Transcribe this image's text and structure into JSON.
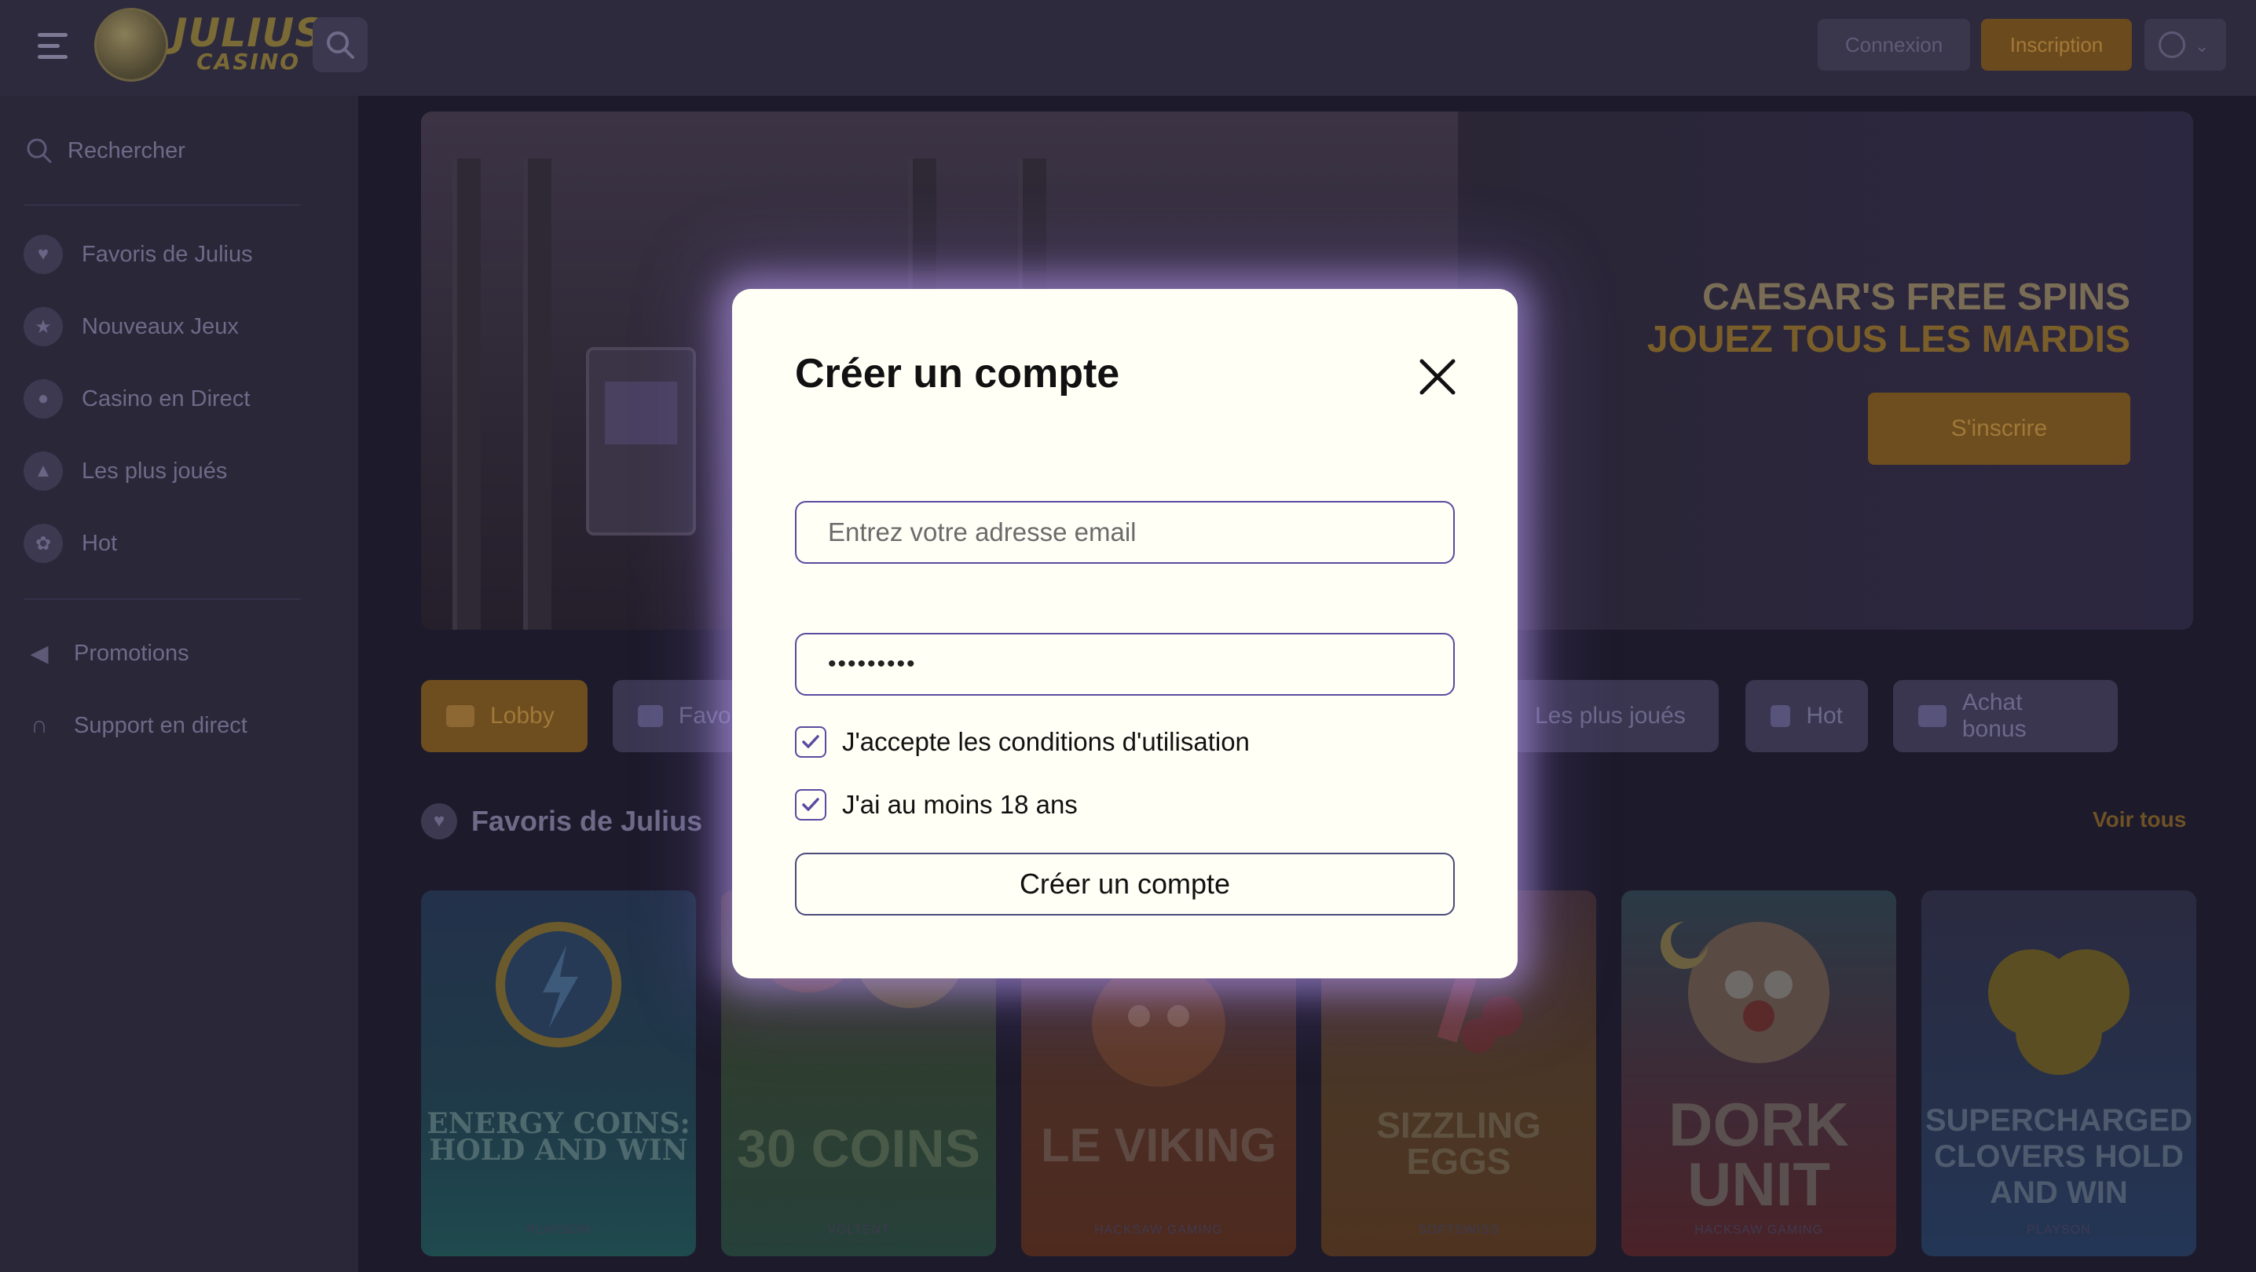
{
  "header": {
    "logo_text": "JULIUS",
    "logo_sub": "CASINO",
    "login_label": "Connexion",
    "register_label": "Inscription"
  },
  "sidebar": {
    "search_label": "Rechercher",
    "items": [
      {
        "label": "Favoris de Julius",
        "icon": "heart-icon"
      },
      {
        "label": "Nouveaux Jeux",
        "icon": "star-icon"
      },
      {
        "label": "Casino en Direct",
        "icon": "live-icon"
      },
      {
        "label": "Les plus joués",
        "icon": "fire-icon"
      },
      {
        "label": "Hot",
        "icon": "hot-icon"
      }
    ],
    "links": [
      {
        "label": "Promotions",
        "icon": "megaphone-icon"
      },
      {
        "label": "Support en direct",
        "icon": "headset-icon"
      }
    ]
  },
  "banner": {
    "line1": "CAESAR'S FREE SPINS",
    "line2": "JOUEZ TOUS LES MARDIS",
    "cta": "S'inscrire"
  },
  "categories": [
    {
      "label": "Lobby",
      "active": true
    },
    {
      "label": "Favoris de Julius"
    },
    {
      "label": "Les plus joués"
    },
    {
      "label": "Hot"
    },
    {
      "label": "Achat bonus"
    }
  ],
  "favorites": {
    "title": "Favoris de Julius",
    "see_all": "Voir tous",
    "games": [
      {
        "title": "ENERGY COINS: HOLD AND WIN",
        "provider": "PLAYSON"
      },
      {
        "title": "30 COINS",
        "provider": "VOLTENT"
      },
      {
        "title": "LE VIKING",
        "provider": "HACKSAW GAMING"
      },
      {
        "title": "SIZZLING EGGS",
        "provider": "SOFTSWISS"
      },
      {
        "title": "DORK UNIT",
        "provider": "HACKSAW GAMING"
      },
      {
        "title": "SUPERCHARGED CLOVERS HOLD AND WIN",
        "provider": "PLAYSON"
      }
    ]
  },
  "modal": {
    "title": "Créer un compte",
    "email_placeholder": "Entrez votre adresse email",
    "password_value": "•••••••••",
    "terms_label": "J'accepte les conditions d'utilisation",
    "terms_checked": true,
    "age_label": "J'ai au moins 18 ans",
    "age_checked": true,
    "submit_label": "Créer un compte"
  },
  "colors": {
    "accent": "#6e4d1f",
    "modal_border": "#5a4ba0",
    "modal_glow": "#b096e8"
  }
}
